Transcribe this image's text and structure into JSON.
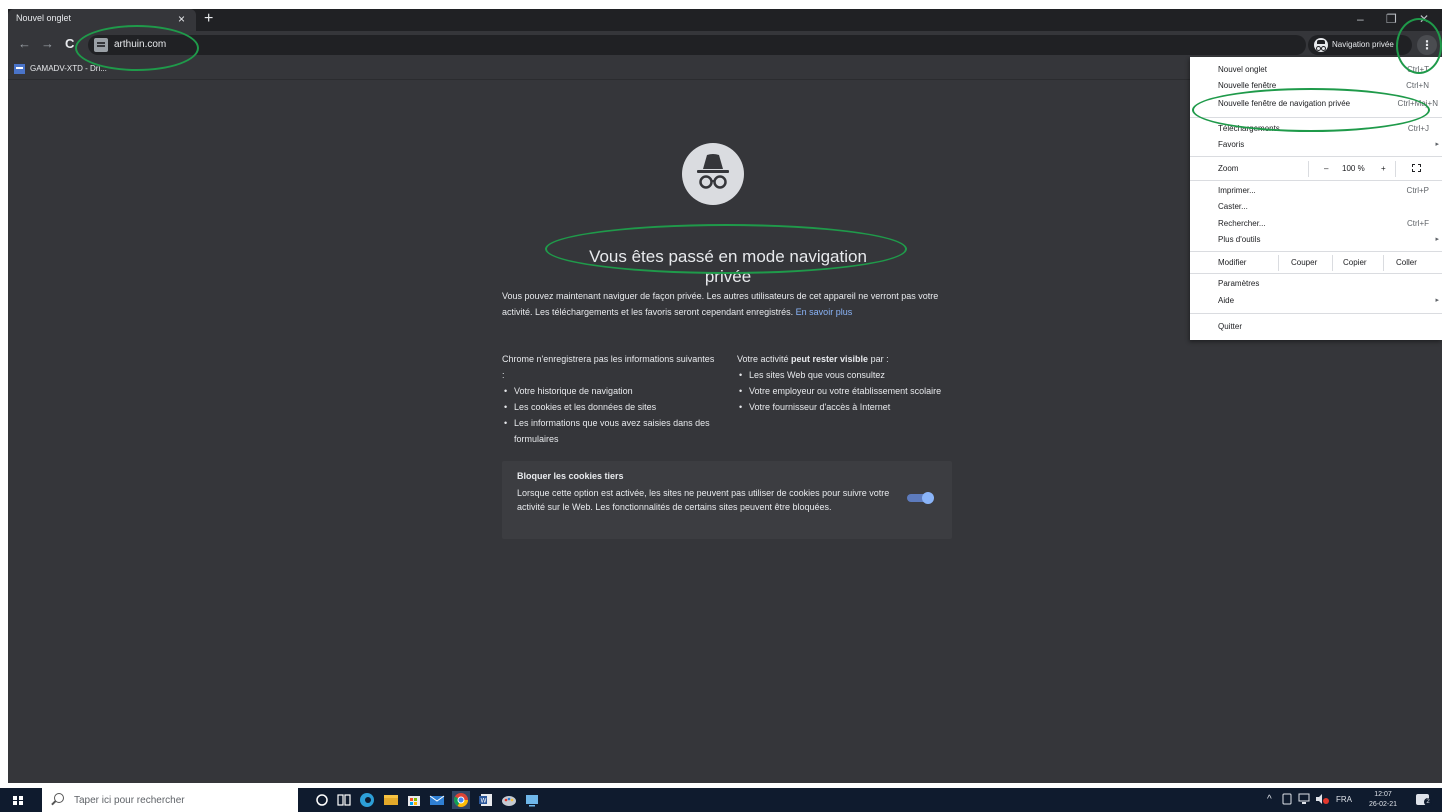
{
  "browser": {
    "tab_title": "Nouvel onglet",
    "tab_close": "×",
    "new_tab": "+",
    "window_minimize": "–",
    "window_restore": "❐",
    "window_close": "✕",
    "nav_back": "←",
    "nav_forward": "→",
    "nav_reload": "C",
    "url": "arthuin.com",
    "incognito_chip": "Navigation privée",
    "menu_button": "⋮",
    "bookmark": "GAMADV-XTD - Dri..."
  },
  "page": {
    "title": "Vous êtes passé en mode navigation privée",
    "intro": "Vous pouvez maintenant naviguer de façon privée. Les autres utilisateurs de cet appareil ne verront pas votre activité. Les téléchargements et les favoris seront cependant enregistrés.",
    "intro_link": "En savoir plus",
    "col_left_heading": "Chrome n'enregistrera pas les informations suivantes :",
    "col_left_items": [
      "Votre historique de navigation",
      "Les cookies et les données de sites",
      "Les informations que vous avez saisies dans des formulaires"
    ],
    "col_right_heading_pre": "Votre activité ",
    "col_right_heading_bold": "peut rester visible",
    "col_right_heading_post": " par :",
    "col_right_items": [
      "Les sites Web que vous consultez",
      "Votre employeur ou votre établissement scolaire",
      "Votre fournisseur d'accès à Internet"
    ],
    "cookie_title": "Bloquer les cookies tiers",
    "cookie_text": "Lorsque cette option est activée, les sites ne peuvent pas utiliser de cookies pour suivre votre activité sur le Web. Les fonctionnalités de certains sites peuvent être bloquées."
  },
  "menu": {
    "new_tab": "Nouvel onglet",
    "new_tab_sc": "Ctrl+T",
    "new_window": "Nouvelle fenêtre",
    "new_window_sc": "Ctrl+N",
    "new_incognito": "Nouvelle fenêtre de navigation privée",
    "new_incognito_sc": "Ctrl+Maj+N",
    "downloads": "Téléchargements",
    "downloads_sc": "Ctrl+J",
    "favorites": "Favoris",
    "zoom": "Zoom",
    "zoom_minus": "–",
    "zoom_value": "100 %",
    "zoom_plus": "+",
    "print": "Imprimer...",
    "print_sc": "Ctrl+P",
    "cast": "Caster...",
    "find": "Rechercher...",
    "find_sc": "Ctrl+F",
    "more_tools": "Plus d'outils",
    "edit": "Modifier",
    "cut": "Couper",
    "copy": "Copier",
    "paste": "Coller",
    "settings": "Paramètres",
    "help": "Aide",
    "quit": "Quitter",
    "arrow": "▸"
  },
  "taskbar": {
    "search_placeholder": "Taper ici pour rechercher",
    "tray_arrow": "^",
    "language": "FRA",
    "time": "12:07",
    "date": "26-02-21"
  },
  "colors": {
    "accent": "#8ab4f8",
    "annotation": "#1f9a4a",
    "page_bg": "#35363a"
  }
}
